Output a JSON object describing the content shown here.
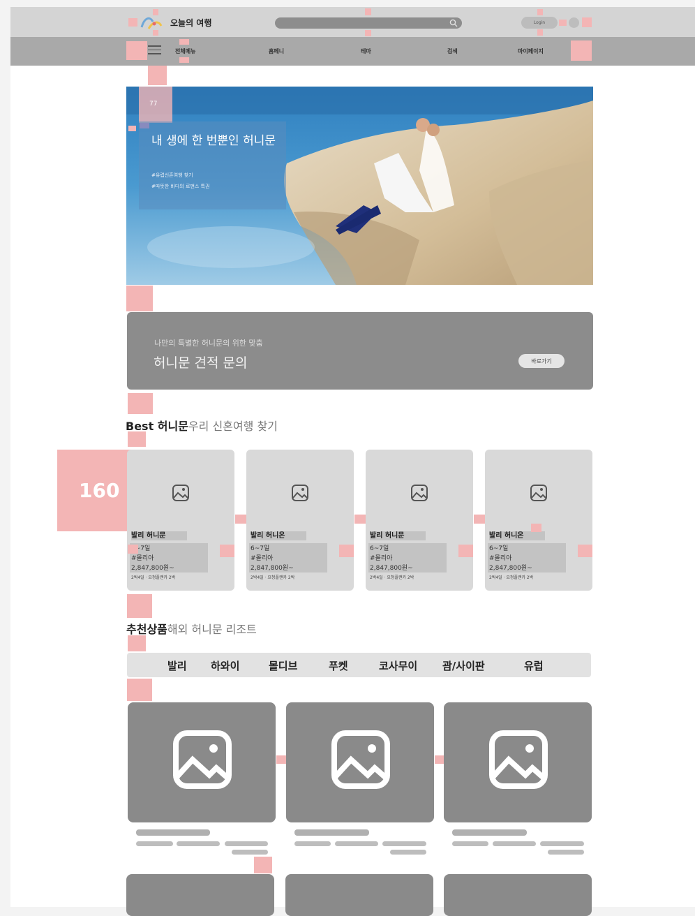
{
  "header": {
    "site_name": "오늘의 여행",
    "login_label": "Login",
    "nav": [
      "전체메뉴",
      "홈페니",
      "테마",
      "검색",
      "마이페이지"
    ]
  },
  "hero": {
    "badge": "77",
    "title": "내 생에 한 번뿐인 허니문",
    "tag1": "#유럽신혼여행 찾기",
    "tag2": "#따뜻한 바다의 로맨스 특권"
  },
  "quote": {
    "subtitle": "나만의 특별한 허니문의 위한 맞춤",
    "title": "허니문 견적 문의",
    "button": "바로가기"
  },
  "best": {
    "title_bold": "Best 허니문",
    "title_light": "우리 신혼여행 찾기",
    "marker_label": "160",
    "cards": [
      {
        "name": "발리 허니문",
        "days": "6~7일",
        "tag": "#몰리아",
        "price": "2,847,800원~",
        "note": "2박4일 · 요청플랜카 2박"
      },
      {
        "name": "발리 허니온",
        "days": "6~7일",
        "tag": "#몰리아",
        "price": "2,847,800원~",
        "note": "2박4일 · 요청플랜카 2박"
      },
      {
        "name": "발리 허니문",
        "days": "6~7일",
        "tag": "#몰리아",
        "price": "2,847,800원~",
        "note": "2박4일 · 요청플랜카 2박"
      },
      {
        "name": "발리 허니온",
        "days": "6~7일",
        "tag": "#몰리아",
        "price": "2,847,800원~",
        "note": "2박4일 · 요청플랜카 2박"
      }
    ]
  },
  "recommend": {
    "title_bold": "추천상품",
    "title_light": "해외 허니문 리조트",
    "tabs": [
      "발리",
      "하와이",
      "몰디브",
      "푸켓",
      "코사무이",
      "괌/사이판",
      "유럽"
    ]
  },
  "colors": {
    "marker": "#f3b5b5",
    "topbar": "#d4d4d4",
    "navbar": "#a9a9a9",
    "placeholder": "#8a8a8a",
    "card": "#d9d9d9"
  }
}
